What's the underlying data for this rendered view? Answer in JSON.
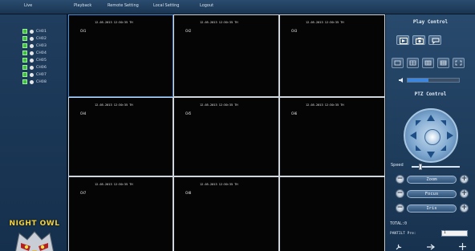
{
  "menu": {
    "items": [
      "Live",
      "Playback",
      "Remote Setting",
      "Local Setting",
      "Logout"
    ]
  },
  "channels": [
    {
      "label": "CH01"
    },
    {
      "label": "CH02"
    },
    {
      "label": "CH03"
    },
    {
      "label": "CH04"
    },
    {
      "label": "CH05"
    },
    {
      "label": "CH06"
    },
    {
      "label": "CH07"
    },
    {
      "label": "CH08"
    }
  ],
  "logo": {
    "text": "NIGHT OWL",
    "icon": "owl-logo-icon"
  },
  "grid": {
    "cells": [
      {
        "timestamp": "12-05-2013 12:30:35 TH",
        "channel": "CH1"
      },
      {
        "timestamp": "12-05-2013 12:30:35 TH",
        "channel": "CH2"
      },
      {
        "timestamp": "12-05-2013 12:30:35 TH",
        "channel": "CH3"
      },
      {
        "timestamp": "12-05-2013 12:30:35 TH",
        "channel": "CH4"
      },
      {
        "timestamp": "12-05-2013 12:30:35 TH",
        "channel": "CH5"
      },
      {
        "timestamp": "12-05-2013 12:30:35 TH",
        "channel": "CH6"
      },
      {
        "timestamp": "12-05-2013 12:30:35 TH",
        "channel": "CH7"
      },
      {
        "timestamp": "12-05-2013 12:30:35 TH",
        "channel": "CH8"
      },
      {
        "timestamp": "",
        "channel": ""
      }
    ]
  },
  "play_control": {
    "title": "Play Control",
    "buttons": [
      "record-icon",
      "snapshot-icon",
      "talk-icon"
    ],
    "layouts": [
      "layout-1-icon",
      "layout-4-icon",
      "layout-9-icon",
      "layout-16-icon",
      "fullscreen-icon"
    ],
    "volume": {
      "icon": "speaker-icon",
      "level": 0.4
    }
  },
  "ptz": {
    "title": "PTZ Control",
    "speed_label": "Speed",
    "speed_level": 0.15,
    "zoom": "Zoom",
    "focus": "Focus",
    "iris": "Iris",
    "minus": "−",
    "plus": "+",
    "total": "TOTAL:0",
    "preset_label": "PANTILT Pre:",
    "preset_value": "1",
    "bottom_icons": [
      "wrench-icon",
      "arrow-right-icon",
      "cross-icon"
    ]
  },
  "colors": {
    "accent": "#3d86e0",
    "channel_on": "#3fbf3f",
    "logo": "#f5d23a"
  }
}
